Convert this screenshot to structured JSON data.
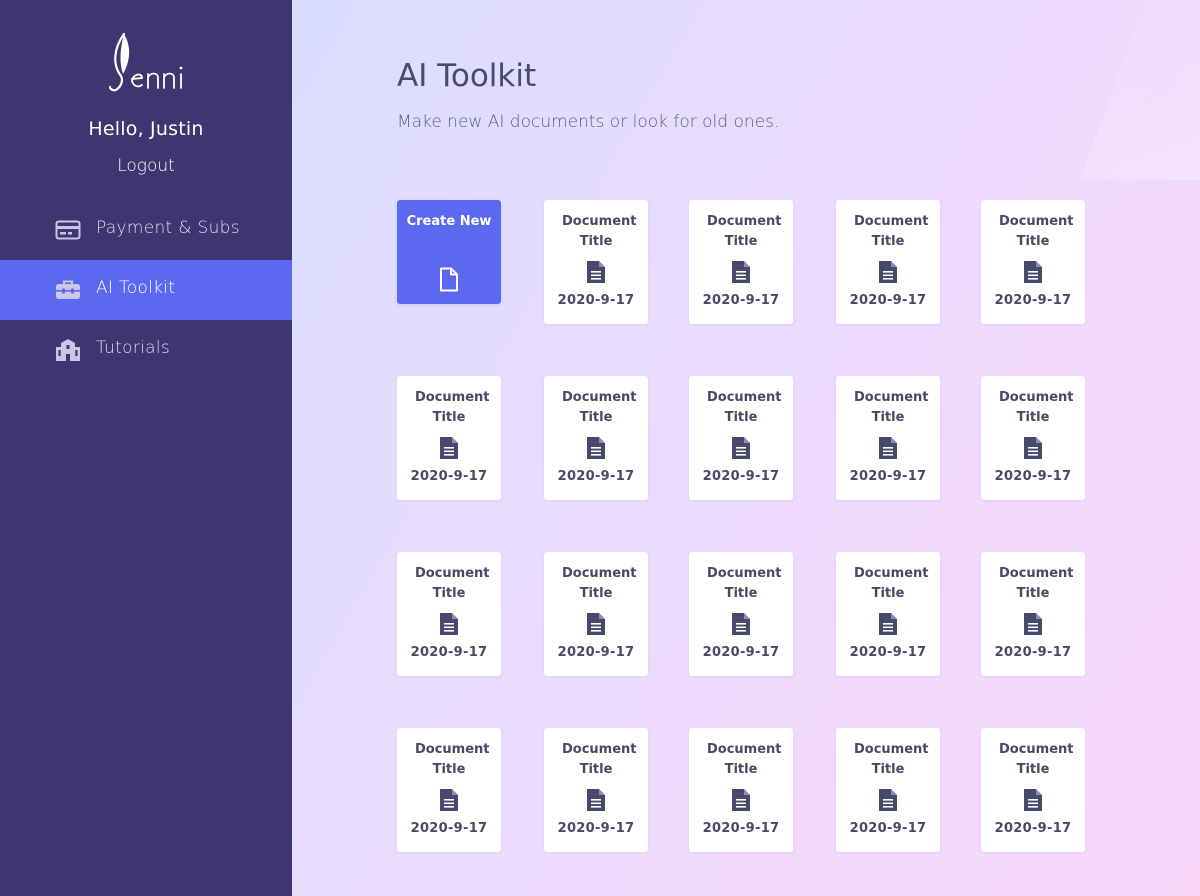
{
  "sidebar": {
    "logo_text": "Jenni",
    "greeting": "Hello, Justin",
    "logout_label": "Logout",
    "items": [
      {
        "label": "Payment & Subs",
        "icon": "credit-card-icon",
        "active": false
      },
      {
        "label": "AI Toolkit",
        "icon": "toolbox-icon",
        "active": true
      },
      {
        "label": "Tutorials",
        "icon": "school-icon",
        "active": false
      }
    ]
  },
  "main": {
    "title": "AI Toolkit",
    "subtitle": "Make new AI documents or look for old ones.",
    "create_card": {
      "label": "Create New",
      "icon": "new-file-icon"
    },
    "documents": [
      {
        "title": "Document Title",
        "date": "2020-9-17"
      },
      {
        "title": "Document Title",
        "date": "2020-9-17"
      },
      {
        "title": "Document Title",
        "date": "2020-9-17"
      },
      {
        "title": "Document Title",
        "date": "2020-9-17"
      },
      {
        "title": "Document Title",
        "date": "2020-9-17"
      },
      {
        "title": "Document Title",
        "date": "2020-9-17"
      },
      {
        "title": "Document Title",
        "date": "2020-9-17"
      },
      {
        "title": "Document Title",
        "date": "2020-9-17"
      },
      {
        "title": "Document Title",
        "date": "2020-9-17"
      },
      {
        "title": "Document Title",
        "date": "2020-9-17"
      },
      {
        "title": "Document Title",
        "date": "2020-9-17"
      },
      {
        "title": "Document Title",
        "date": "2020-9-17"
      },
      {
        "title": "Document Title",
        "date": "2020-9-17"
      },
      {
        "title": "Document Title",
        "date": "2020-9-17"
      },
      {
        "title": "Document Title",
        "date": "2020-9-17"
      },
      {
        "title": "Document Title",
        "date": "2020-9-17"
      },
      {
        "title": "Document Title",
        "date": "2020-9-17"
      },
      {
        "title": "Document Title",
        "date": "2020-9-17"
      },
      {
        "title": "Document Title",
        "date": "2020-9-17"
      }
    ]
  },
  "colors": {
    "sidebar_bg": "#3d3670",
    "accent": "#5b68f0",
    "text_dark": "#464a62"
  }
}
